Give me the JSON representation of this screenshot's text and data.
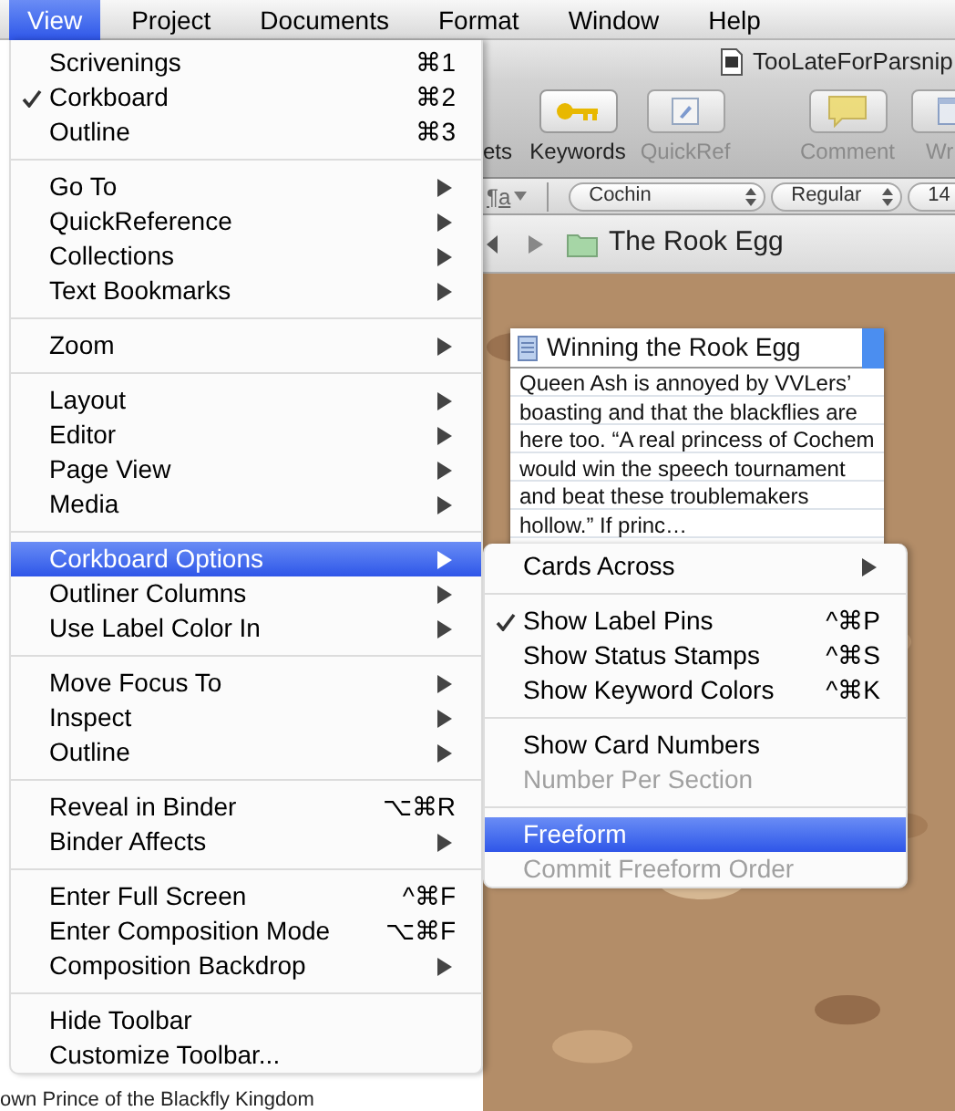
{
  "menu_bar": [
    {
      "label": "View",
      "selected": true
    },
    {
      "label": "Project",
      "selected": false
    },
    {
      "label": "Documents",
      "selected": false
    },
    {
      "label": "Format",
      "selected": false
    },
    {
      "label": "Window",
      "selected": false
    },
    {
      "label": "Help",
      "selected": false
    }
  ],
  "window": {
    "title": "TooLateForParsnip",
    "toolbar": [
      {
        "label": "ets",
        "kind": "cut"
      },
      {
        "label": "Keywords",
        "kind": "keywords",
        "disabled": false
      },
      {
        "label": "QuickRef",
        "kind": "quickref",
        "disabled": true
      },
      {
        "label": "Comment",
        "kind": "comment",
        "disabled": true
      },
      {
        "label": "Wr",
        "kind": "write",
        "disabled": true
      }
    ],
    "format_bar": {
      "paragraph_button": "¶a",
      "font": "Cochin",
      "style": "Regular",
      "size": "14"
    },
    "header": {
      "title": "The Rook Egg"
    },
    "card": {
      "title": "Winning the Rook Egg",
      "text": "Queen Ash is annoyed by VVLers’ boasting and that the blackflies are here too. “A real princess of Cochem would win the speech tournament and  beat these troublemakers hollow.” If princ…"
    },
    "binder_visible_row": "own Prince of the Blackfly Kingdom"
  },
  "view_menu": [
    [
      {
        "label": "Scrivenings",
        "shortcut": "⌘1",
        "submenu": false,
        "checked": false,
        "selected": false,
        "disabled": false
      },
      {
        "label": "Corkboard",
        "shortcut": "⌘2",
        "submenu": false,
        "checked": true,
        "selected": false,
        "disabled": false
      },
      {
        "label": "Outline",
        "shortcut": "⌘3",
        "submenu": false,
        "checked": false,
        "selected": false,
        "disabled": false
      }
    ],
    [
      {
        "label": "Go To",
        "submenu": true,
        "checked": false,
        "selected": false,
        "disabled": false
      },
      {
        "label": "QuickReference",
        "submenu": true,
        "checked": false,
        "selected": false,
        "disabled": false
      },
      {
        "label": "Collections",
        "submenu": true,
        "checked": false,
        "selected": false,
        "disabled": false
      },
      {
        "label": "Text Bookmarks",
        "submenu": true,
        "checked": false,
        "selected": false,
        "disabled": false
      }
    ],
    [
      {
        "label": "Zoom",
        "submenu": true,
        "checked": false,
        "selected": false,
        "disabled": false
      }
    ],
    [
      {
        "label": "Layout",
        "submenu": true,
        "checked": false,
        "selected": false,
        "disabled": false
      },
      {
        "label": "Editor",
        "submenu": true,
        "checked": false,
        "selected": false,
        "disabled": false
      },
      {
        "label": "Page View",
        "submenu": true,
        "checked": false,
        "selected": false,
        "disabled": false
      },
      {
        "label": "Media",
        "submenu": true,
        "checked": false,
        "selected": false,
        "disabled": false
      }
    ],
    [
      {
        "label": "Corkboard Options",
        "submenu": true,
        "checked": false,
        "selected": true,
        "disabled": false
      },
      {
        "label": "Outliner Columns",
        "submenu": true,
        "checked": false,
        "selected": false,
        "disabled": false
      },
      {
        "label": "Use Label Color In",
        "submenu": true,
        "checked": false,
        "selected": false,
        "disabled": false
      }
    ],
    [
      {
        "label": "Move Focus To",
        "submenu": true,
        "checked": false,
        "selected": false,
        "disabled": false
      },
      {
        "label": "Inspect",
        "submenu": true,
        "checked": false,
        "selected": false,
        "disabled": false
      },
      {
        "label": "Outline",
        "submenu": true,
        "checked": false,
        "selected": false,
        "disabled": false
      }
    ],
    [
      {
        "label": "Reveal in Binder",
        "shortcut": "⌥⌘R",
        "submenu": false,
        "checked": false,
        "selected": false,
        "disabled": false
      },
      {
        "label": "Binder Affects",
        "submenu": true,
        "checked": false,
        "selected": false,
        "disabled": false
      }
    ],
    [
      {
        "label": "Enter Full Screen",
        "shortcut": "^⌘F",
        "submenu": false,
        "checked": false,
        "selected": false,
        "disabled": false
      },
      {
        "label": "Enter Composition Mode",
        "shortcut": "⌥⌘F",
        "submenu": false,
        "checked": false,
        "selected": false,
        "disabled": false
      },
      {
        "label": "Composition Backdrop",
        "submenu": true,
        "checked": false,
        "selected": false,
        "disabled": false
      }
    ],
    [
      {
        "label": "Hide Toolbar",
        "submenu": false,
        "checked": false,
        "selected": false,
        "disabled": false
      },
      {
        "label": "Customize Toolbar...",
        "submenu": false,
        "checked": false,
        "selected": false,
        "disabled": false
      }
    ]
  ],
  "corkboard_options_menu": [
    [
      {
        "label": "Cards Across",
        "submenu": true,
        "checked": false,
        "selected": false,
        "disabled": false
      }
    ],
    [
      {
        "label": "Show Label Pins",
        "shortcut": "^⌘P",
        "submenu": false,
        "checked": true,
        "selected": false,
        "disabled": false
      },
      {
        "label": "Show Status Stamps",
        "shortcut": "^⌘S",
        "submenu": false,
        "checked": false,
        "selected": false,
        "disabled": false
      },
      {
        "label": "Show Keyword Colors",
        "shortcut": "^⌘K",
        "submenu": false,
        "checked": false,
        "selected": false,
        "disabled": false
      }
    ],
    [
      {
        "label": "Show Card Numbers",
        "submenu": false,
        "checked": false,
        "selected": false,
        "disabled": false
      },
      {
        "label": "Number Per Section",
        "submenu": false,
        "checked": false,
        "selected": false,
        "disabled": true
      }
    ],
    [
      {
        "label": "Freeform",
        "submenu": false,
        "checked": false,
        "selected": true,
        "disabled": false
      },
      {
        "label": "Commit Freeform Order",
        "submenu": false,
        "checked": false,
        "selected": false,
        "disabled": true
      }
    ]
  ]
}
